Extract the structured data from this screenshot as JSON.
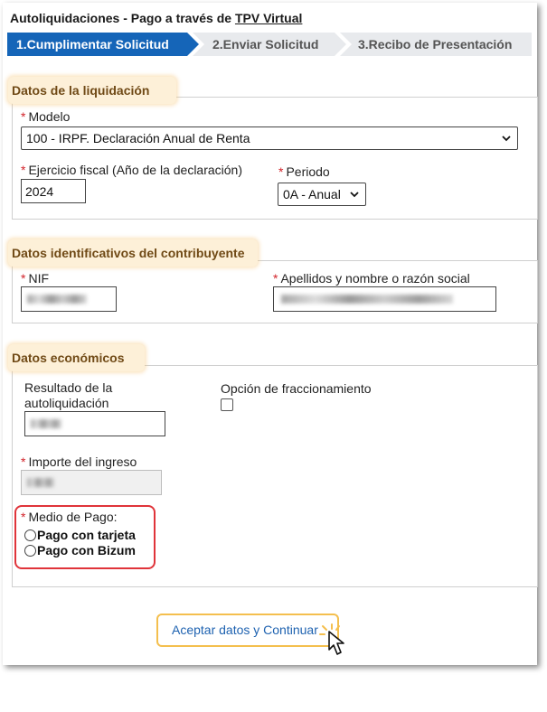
{
  "page": {
    "title_prefix": "Autoliquidaciones - Pago a través de ",
    "title_link": "TPV Virtual"
  },
  "steps": [
    {
      "label": "1.Cumplimentar Solicitud",
      "active": true
    },
    {
      "label": "2.Enviar Solicitud",
      "active": false
    },
    {
      "label": "3.Recibo de Presentación",
      "active": false
    }
  ],
  "sections": {
    "liquidacion": {
      "legend": "Datos de la liquidación",
      "modelo_label": "Modelo",
      "modelo_value": "100 - IRPF. Declaración Anual de Renta",
      "ejercicio_label": "Ejercicio fiscal (Año de la declaración)",
      "ejercicio_value": "2024",
      "periodo_label": "Periodo",
      "periodo_value": "0A - Anual"
    },
    "identificativos": {
      "legend": "Datos identificativos del contribuyente",
      "nif_label": "NIF",
      "nombre_label": "Apellidos y nombre o razón social"
    },
    "economicos": {
      "legend": "Datos económicos",
      "resultado_label_line1": "Resultado de la",
      "resultado_label_line2": "autoliquidación",
      "fraccionamiento_label": "Opción de fraccionamiento",
      "importe_label": "Importe del ingreso",
      "medio_label": "Medio de Pago:",
      "medio_options": [
        "Pago con tarjeta",
        "Pago con Bizum"
      ]
    }
  },
  "required_marker": "*",
  "actions": {
    "accept_label": "Aceptar datos y Continuar"
  },
  "colors": {
    "step_active": "#1565b8",
    "step_inactive": "#e8eaed",
    "legend_bg": "#fdf0d8",
    "legend_text": "#704a16",
    "required": "#d2232a",
    "highlight_red": "#e0343a",
    "highlight_orange": "#f4bf4e",
    "link": "#1e62b0"
  },
  "icons": {
    "select_arrow": "chevron-down-icon",
    "pointer": "hand-pointer-icon"
  }
}
